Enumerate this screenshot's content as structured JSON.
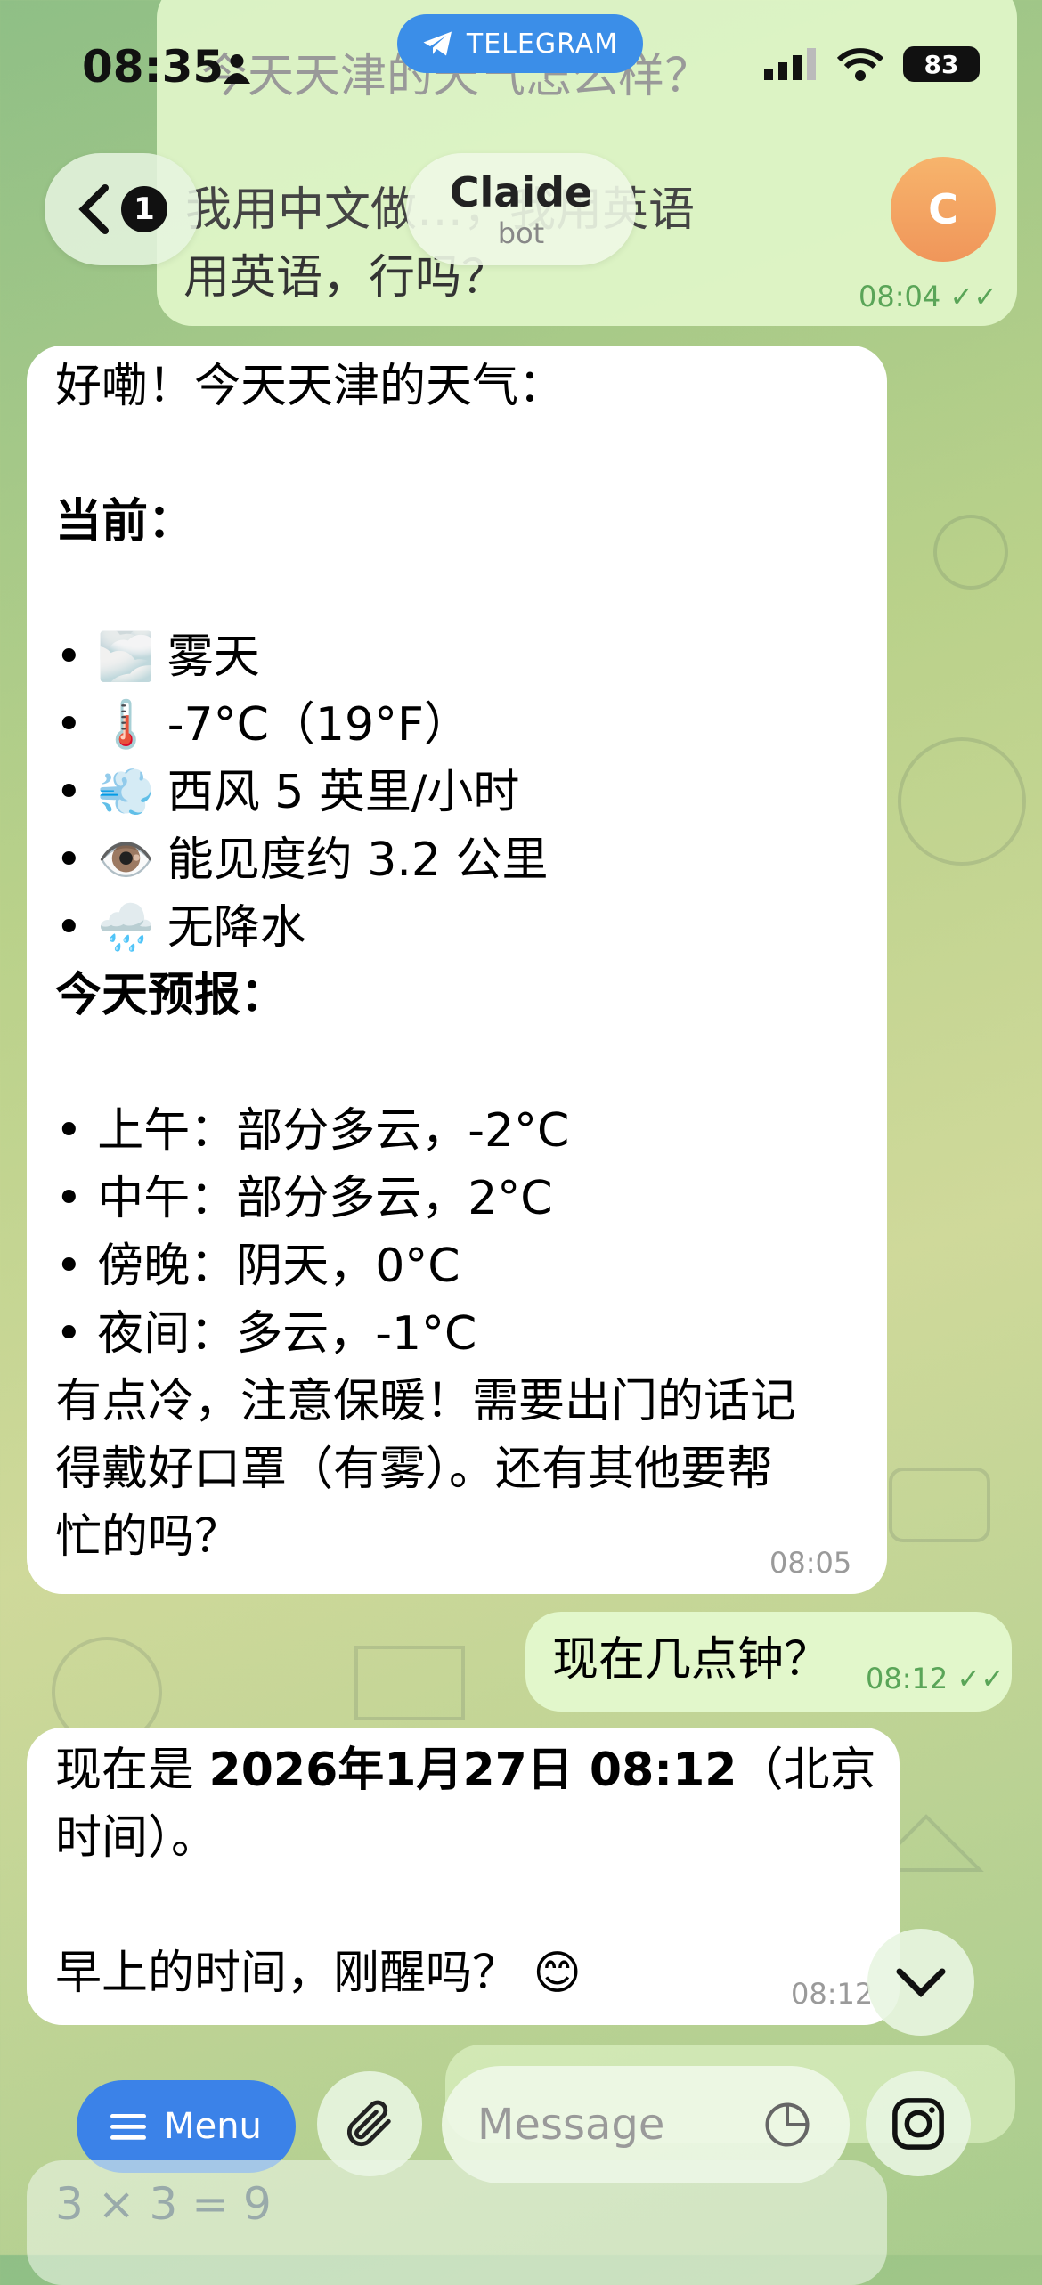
{
  "status_bar": {
    "time": "08:35",
    "battery": "83"
  },
  "app_pill": {
    "label": "TELEGRAM"
  },
  "header": {
    "back_badge": "1",
    "title": "Claide",
    "subtitle": "bot",
    "avatar_letter": "C"
  },
  "partial_top_message": {
    "line1": "今天天津的天气怎么样？",
    "line2": "我用中文做…，我用英语",
    "line3": "用英语，行吗？",
    "time": "08:04"
  },
  "bot_weather_message": {
    "intro": "好嘞！今天天津的天气：",
    "current_heading": "当前：",
    "current_items": [
      {
        "icon": "fog-icon",
        "glyph": "🌫️",
        "text": "雾天"
      },
      {
        "icon": "thermometer-icon",
        "glyph": "🌡️",
        "text": "-7°C（19°F）"
      },
      {
        "icon": "wind-icon",
        "glyph": "💨",
        "text": "西风 5 英里/小时"
      },
      {
        "icon": "eye-icon",
        "glyph": "👁️",
        "text": "能见度约 3.2 公里"
      },
      {
        "icon": "rain-cloud-icon",
        "glyph": "🌧️",
        "text": "无降水"
      }
    ],
    "forecast_heading": "今天预报：",
    "forecast_items": [
      "• 上午：部分多云，-2°C",
      "• 中午：部分多云，2°C",
      "• 傍晚：阴天，0°C",
      "• 夜间：多云，-1°C"
    ],
    "closing_line1": "有点冷，注意保暖！需要出门的话记",
    "closing_line2": "得戴好口罩（有雾）。还有其他要帮",
    "closing_line3": "忙的吗？",
    "time": "08:05"
  },
  "user_time_question": {
    "text": "现在几点钟？",
    "time": "08:12"
  },
  "bot_time_answer": {
    "prefix": "现在是 ",
    "bold": "2026年1月27日 08:12",
    "suffix": "（北京",
    "line2": "时间）。",
    "line3": "早上的时间，刚醒吗？ 😊",
    "time": "08:12"
  },
  "bottom_bar": {
    "menu_label": "Menu",
    "message_placeholder": "Message",
    "partial_below_text": "3 × 3 = 9"
  },
  "colors": {
    "accent": "#3b82e8",
    "out_bubble": "#e2f7cb",
    "check": "#5aa558"
  }
}
